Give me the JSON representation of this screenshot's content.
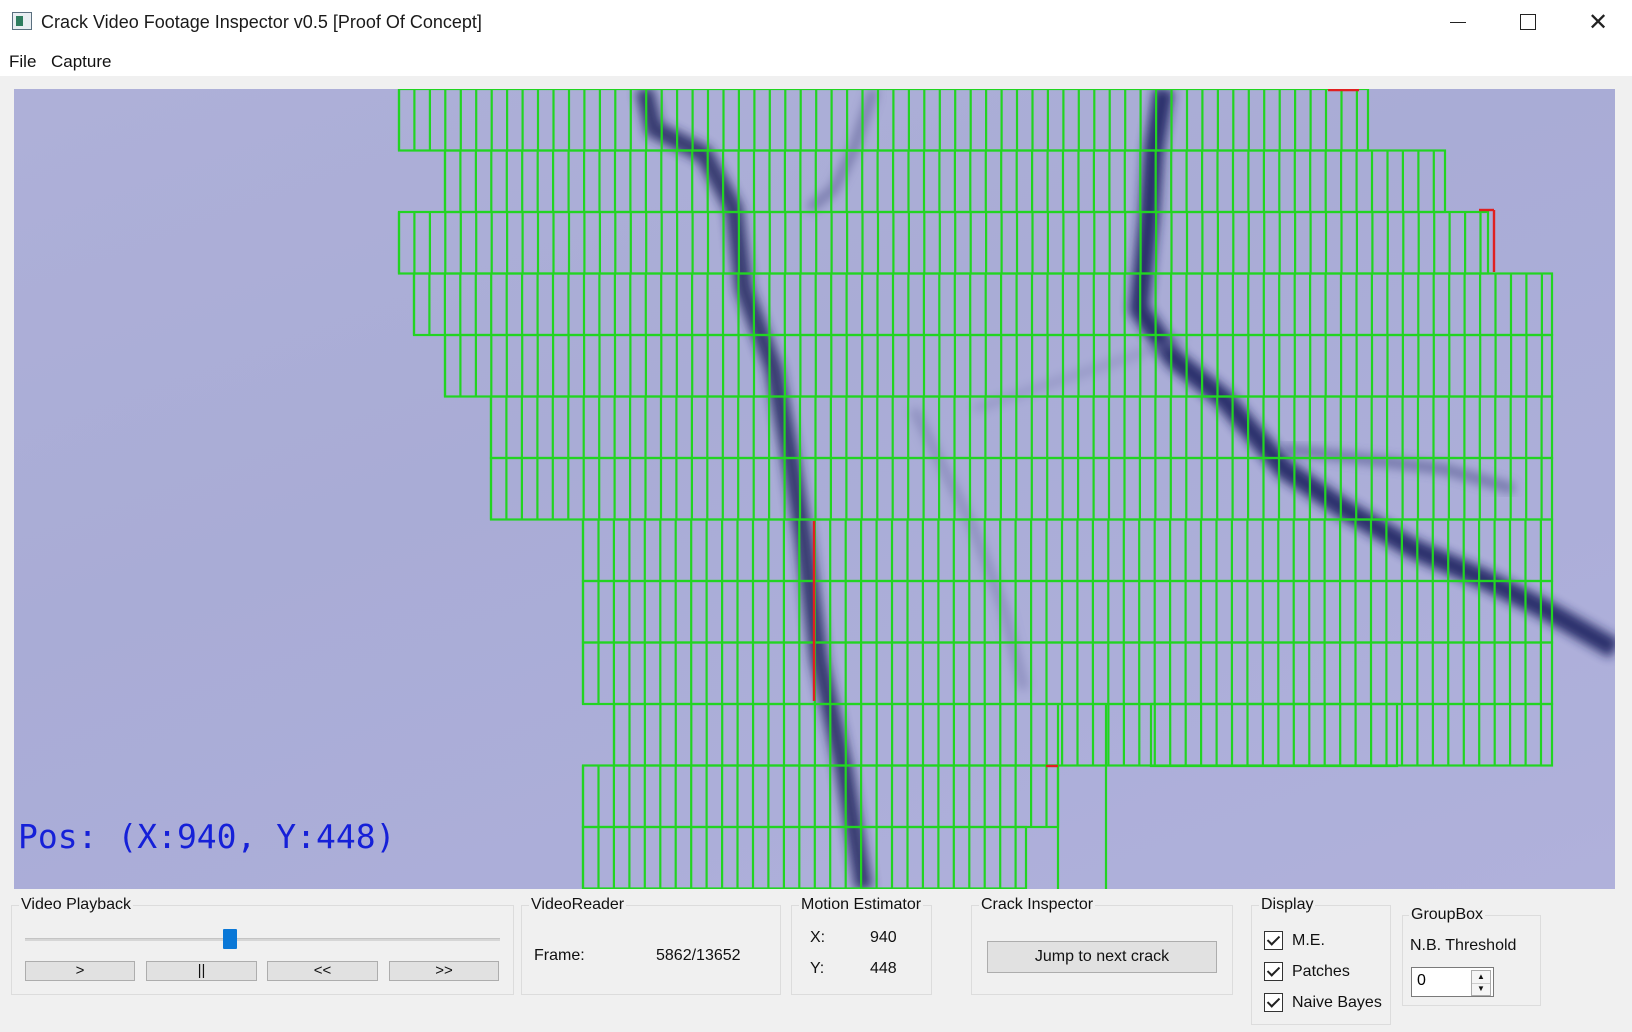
{
  "window": {
    "title": "Crack Video Footage Inspector v0.5 [Proof Of Concept]",
    "controls": {
      "minimize": "─",
      "close": "✕"
    }
  },
  "menu": {
    "file": "File",
    "capture": "Capture"
  },
  "video": {
    "overlay_text": "Pos: (X:940, Y:448)",
    "grid_color": "#22d422",
    "flag_color": "#e02020",
    "overlay_color": "#1520d8"
  },
  "video_playback": {
    "title": "Video Playback",
    "position_fraction": 0.43,
    "buttons": {
      "play": ">",
      "pause": "||",
      "rewind": "<<",
      "forward": ">>"
    }
  },
  "video_reader": {
    "title": "VideoReader",
    "frame_label": "Frame:",
    "frame_value": "5862/13652"
  },
  "motion_estimator": {
    "title": "Motion Estimator",
    "x_label": "X:",
    "x_value": "940",
    "y_label": "Y:",
    "y_value": "448"
  },
  "crack_inspector": {
    "title": "Crack Inspector",
    "jump_button": "Jump to next crack"
  },
  "display": {
    "title": "Display",
    "options": [
      {
        "label": "M.E.",
        "checked": true
      },
      {
        "label": "Patches",
        "checked": true
      },
      {
        "label": "Naive Bayes",
        "checked": true
      }
    ]
  },
  "groupbox": {
    "title": "GroupBox",
    "threshold_label": "N.B. Threshold",
    "threshold_value": "0"
  }
}
